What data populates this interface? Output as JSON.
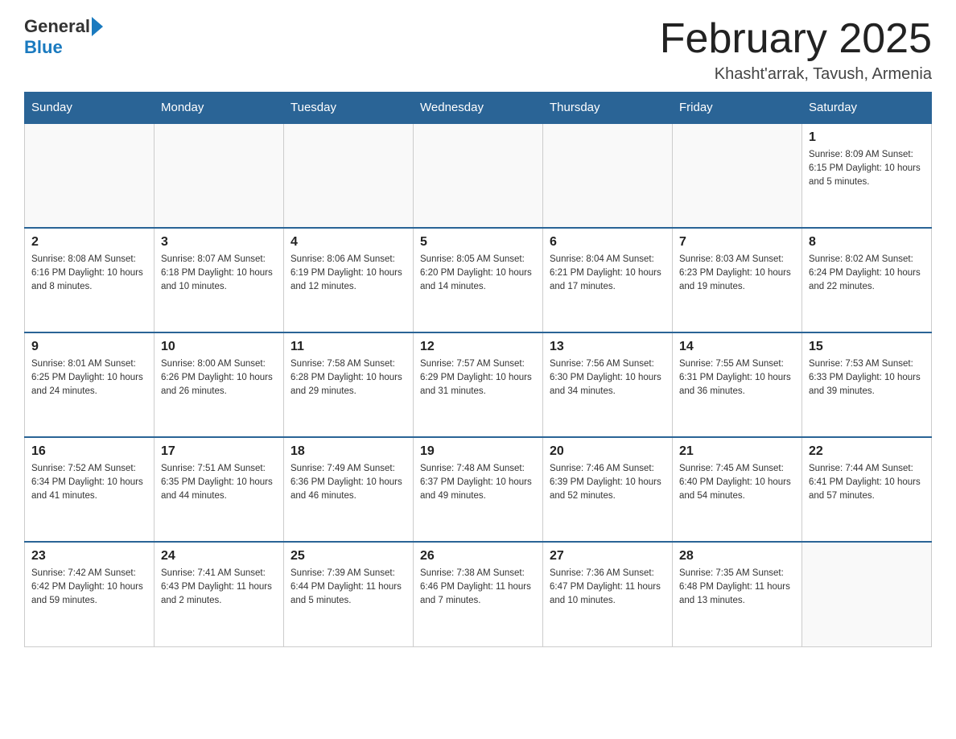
{
  "header": {
    "logo_general": "General",
    "logo_blue": "Blue",
    "month_title": "February 2025",
    "location": "Khasht'arrak, Tavush, Armenia"
  },
  "days_of_week": [
    "Sunday",
    "Monday",
    "Tuesday",
    "Wednesday",
    "Thursday",
    "Friday",
    "Saturday"
  ],
  "weeks": [
    [
      {
        "day": "",
        "info": ""
      },
      {
        "day": "",
        "info": ""
      },
      {
        "day": "",
        "info": ""
      },
      {
        "day": "",
        "info": ""
      },
      {
        "day": "",
        "info": ""
      },
      {
        "day": "",
        "info": ""
      },
      {
        "day": "1",
        "info": "Sunrise: 8:09 AM\nSunset: 6:15 PM\nDaylight: 10 hours and 5 minutes."
      }
    ],
    [
      {
        "day": "2",
        "info": "Sunrise: 8:08 AM\nSunset: 6:16 PM\nDaylight: 10 hours and 8 minutes."
      },
      {
        "day": "3",
        "info": "Sunrise: 8:07 AM\nSunset: 6:18 PM\nDaylight: 10 hours and 10 minutes."
      },
      {
        "day": "4",
        "info": "Sunrise: 8:06 AM\nSunset: 6:19 PM\nDaylight: 10 hours and 12 minutes."
      },
      {
        "day": "5",
        "info": "Sunrise: 8:05 AM\nSunset: 6:20 PM\nDaylight: 10 hours and 14 minutes."
      },
      {
        "day": "6",
        "info": "Sunrise: 8:04 AM\nSunset: 6:21 PM\nDaylight: 10 hours and 17 minutes."
      },
      {
        "day": "7",
        "info": "Sunrise: 8:03 AM\nSunset: 6:23 PM\nDaylight: 10 hours and 19 minutes."
      },
      {
        "day": "8",
        "info": "Sunrise: 8:02 AM\nSunset: 6:24 PM\nDaylight: 10 hours and 22 minutes."
      }
    ],
    [
      {
        "day": "9",
        "info": "Sunrise: 8:01 AM\nSunset: 6:25 PM\nDaylight: 10 hours and 24 minutes."
      },
      {
        "day": "10",
        "info": "Sunrise: 8:00 AM\nSunset: 6:26 PM\nDaylight: 10 hours and 26 minutes."
      },
      {
        "day": "11",
        "info": "Sunrise: 7:58 AM\nSunset: 6:28 PM\nDaylight: 10 hours and 29 minutes."
      },
      {
        "day": "12",
        "info": "Sunrise: 7:57 AM\nSunset: 6:29 PM\nDaylight: 10 hours and 31 minutes."
      },
      {
        "day": "13",
        "info": "Sunrise: 7:56 AM\nSunset: 6:30 PM\nDaylight: 10 hours and 34 minutes."
      },
      {
        "day": "14",
        "info": "Sunrise: 7:55 AM\nSunset: 6:31 PM\nDaylight: 10 hours and 36 minutes."
      },
      {
        "day": "15",
        "info": "Sunrise: 7:53 AM\nSunset: 6:33 PM\nDaylight: 10 hours and 39 minutes."
      }
    ],
    [
      {
        "day": "16",
        "info": "Sunrise: 7:52 AM\nSunset: 6:34 PM\nDaylight: 10 hours and 41 minutes."
      },
      {
        "day": "17",
        "info": "Sunrise: 7:51 AM\nSunset: 6:35 PM\nDaylight: 10 hours and 44 minutes."
      },
      {
        "day": "18",
        "info": "Sunrise: 7:49 AM\nSunset: 6:36 PM\nDaylight: 10 hours and 46 minutes."
      },
      {
        "day": "19",
        "info": "Sunrise: 7:48 AM\nSunset: 6:37 PM\nDaylight: 10 hours and 49 minutes."
      },
      {
        "day": "20",
        "info": "Sunrise: 7:46 AM\nSunset: 6:39 PM\nDaylight: 10 hours and 52 minutes."
      },
      {
        "day": "21",
        "info": "Sunrise: 7:45 AM\nSunset: 6:40 PM\nDaylight: 10 hours and 54 minutes."
      },
      {
        "day": "22",
        "info": "Sunrise: 7:44 AM\nSunset: 6:41 PM\nDaylight: 10 hours and 57 minutes."
      }
    ],
    [
      {
        "day": "23",
        "info": "Sunrise: 7:42 AM\nSunset: 6:42 PM\nDaylight: 10 hours and 59 minutes."
      },
      {
        "day": "24",
        "info": "Sunrise: 7:41 AM\nSunset: 6:43 PM\nDaylight: 11 hours and 2 minutes."
      },
      {
        "day": "25",
        "info": "Sunrise: 7:39 AM\nSunset: 6:44 PM\nDaylight: 11 hours and 5 minutes."
      },
      {
        "day": "26",
        "info": "Sunrise: 7:38 AM\nSunset: 6:46 PM\nDaylight: 11 hours and 7 minutes."
      },
      {
        "day": "27",
        "info": "Sunrise: 7:36 AM\nSunset: 6:47 PM\nDaylight: 11 hours and 10 minutes."
      },
      {
        "day": "28",
        "info": "Sunrise: 7:35 AM\nSunset: 6:48 PM\nDaylight: 11 hours and 13 minutes."
      },
      {
        "day": "",
        "info": ""
      }
    ]
  ]
}
